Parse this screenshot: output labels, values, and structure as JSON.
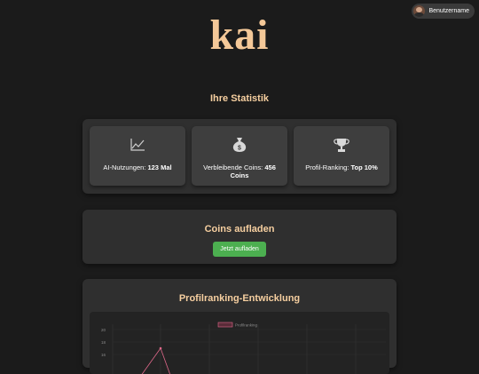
{
  "header": {
    "logo": "kai",
    "user": {
      "name": "Benutzername"
    }
  },
  "stats": {
    "title": "Ihre Statistik",
    "cards": [
      {
        "icon": "line-chart-icon",
        "label": "AI-Nutzungen:",
        "value": "123 Mal"
      },
      {
        "icon": "money-bag-icon",
        "label": "Verbleibende Coins:",
        "value": "456 Coins"
      },
      {
        "icon": "trophy-icon",
        "label": "Profil-Ranking:",
        "value": "Top 10%"
      }
    ]
  },
  "coins": {
    "title": "Coins aufladen",
    "button_label": "Jetzt aufladen"
  },
  "ranking_chart": {
    "title": "Profilranking-Entwicklung"
  },
  "chart_data": {
    "type": "line",
    "title": "Profilranking-Entwicklung",
    "series": [
      {
        "name": "Profilranking",
        "color": "#e0688a",
        "values": [
          12,
          17
        ]
      }
    ],
    "y_ticks": [
      "20",
      "18",
      "16"
    ],
    "grid": true,
    "legend": "top-center"
  },
  "colors": {
    "accent": "#f6cfa0",
    "button": "#4caf50",
    "line": "#e0688a"
  }
}
